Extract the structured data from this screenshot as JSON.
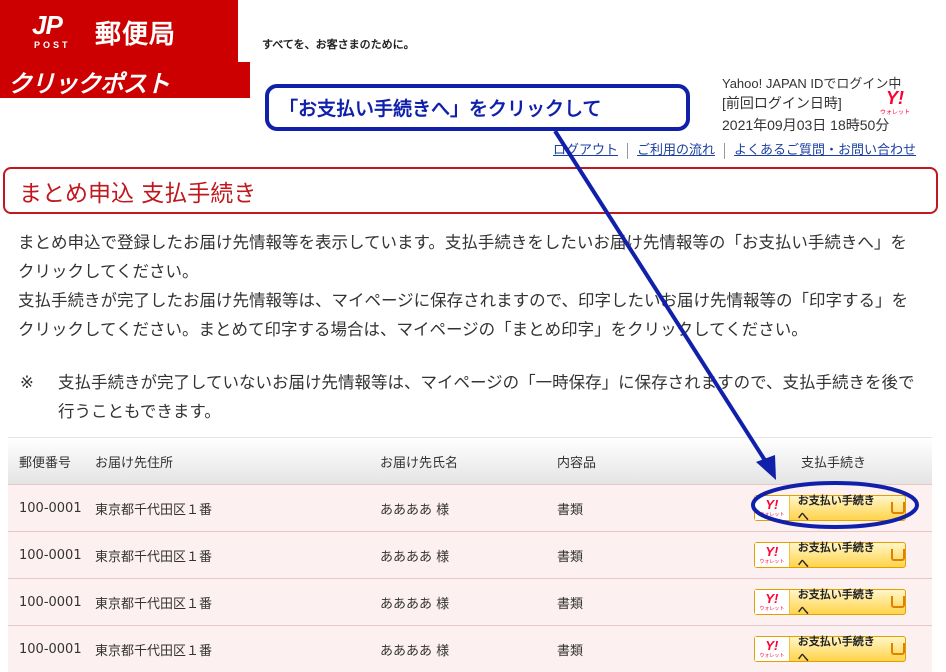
{
  "header": {
    "logo_mark": "JP",
    "logo_post": "POST",
    "logo_name": "郵便局",
    "tagline": "すべてを、お客さまのために。",
    "service_title": "クリックポスト"
  },
  "login": {
    "line1": "Yahoo! JAPAN IDでログイン中",
    "line2": "[前回ログイン日時]",
    "line3": "2021年09月03日 18時50分",
    "wallet_y": "Y!",
    "wallet_label": "ウォレット"
  },
  "links": {
    "logout": "ログアウト",
    "usage_flow": "ご利用の流れ",
    "faq": "よくあるご質問・お問い合わせ"
  },
  "callout": {
    "text": "「お支払い手続きへ」をクリックして"
  },
  "page": {
    "title": "まとめ申込 支払手続き",
    "para1": "まとめ申込で登録したお届け先情報等を表示しています。支払手続きをしたいお届け先情報等の「お支払い手続きへ」をクリックしてください。",
    "para2": "支払手続きが完了したお届け先情報等は、マイページに保存されますので、印字したいお届け先情報等の「印字する」をクリックしてください。まとめて印字する場合は、マイページの「まとめ印字」をクリックしてください。",
    "note_mark": "※",
    "note": "支払手続きが完了していないお届け先情報等は、マイページの「一時保存」に保存されますので、支払手続きを後で行うこともできます。"
  },
  "table": {
    "headers": {
      "zip": "郵便番号",
      "address": "お届け先住所",
      "name": "お届け先氏名",
      "contents": "内容品",
      "payment": "支払手続き"
    },
    "rows": [
      {
        "zip": "100-0001",
        "address": "東京都千代田区１番",
        "name": "ああああ 様",
        "contents": "書類"
      },
      {
        "zip": "100-0001",
        "address": "東京都千代田区１番",
        "name": "ああああ 様",
        "contents": "書類"
      },
      {
        "zip": "100-0001",
        "address": "東京都千代田区１番",
        "name": "ああああ 様",
        "contents": "書類"
      },
      {
        "zip": "100-0001",
        "address": "東京都千代田区１番",
        "name": "ああああ 様",
        "contents": "書類"
      }
    ],
    "pay_button": {
      "wallet_y": "Y!",
      "wallet_label": "ウォレット",
      "label": "お支払い手続きへ"
    }
  },
  "colors": {
    "brand_red": "#cc0000",
    "annotation_blue": "#1020aa",
    "link_blue": "#1a3fa0"
  }
}
